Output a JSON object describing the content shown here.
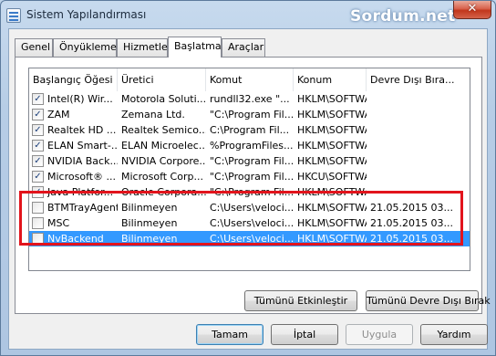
{
  "window": {
    "title": "Sistem Yapılandırması",
    "watermark": "Sordum.net",
    "close_glyph": "✕"
  },
  "tabs": [
    {
      "label": "Genel",
      "active": false
    },
    {
      "label": "Önyükleme",
      "active": false
    },
    {
      "label": "Hizmetler",
      "active": false
    },
    {
      "label": "Başlatma",
      "active": true
    },
    {
      "label": "Araçlar",
      "active": false
    }
  ],
  "list": {
    "columns": [
      "Başlangıç Öğesi",
      "Üretici",
      "Komut",
      "Konum",
      "Devre Dışı Bıra..."
    ],
    "rows": [
      {
        "checked": true,
        "item": "Intel(R) Wir...",
        "manufacturer": "Motorola Soluti...",
        "command": "rundll32.exe \"...",
        "location": "HKLM\\SOFTWARE...",
        "disabled": ""
      },
      {
        "checked": true,
        "item": "ZAM",
        "manufacturer": "Zemana Ltd.",
        "command": "\"C:\\Program Fil...",
        "location": "HKLM\\SOFTWARE...",
        "disabled": ""
      },
      {
        "checked": true,
        "item": "Realtek HD ...",
        "manufacturer": "Realtek Semico...",
        "command": "C:\\Program Fil...",
        "location": "HKLM\\SOFTWARE...",
        "disabled": ""
      },
      {
        "checked": true,
        "item": "ELAN Smart-...",
        "manufacturer": "ELAN Microelec...",
        "command": "%ProgramFiles...",
        "location": "HKLM\\SOFTWARE...",
        "disabled": ""
      },
      {
        "checked": true,
        "item": "NVIDIA Back...",
        "manufacturer": "NVIDIA Corpore...",
        "command": "\"C:\\Program Fil...",
        "location": "HKLM\\SOFTWARE...",
        "disabled": ""
      },
      {
        "checked": true,
        "item": "Microsoft® ...",
        "manufacturer": "Microsoft Corp...",
        "command": "\"C:\\Program Fil...",
        "location": "HKCU\\SOFTWARE...",
        "disabled": ""
      },
      {
        "checked": true,
        "item": "Java Platfor...",
        "manufacturer": "Oracle Corpora...",
        "command": "\"C:\\Program Fil...",
        "location": "HKLM\\SOFTWARE...",
        "disabled": ""
      },
      {
        "checked": false,
        "item": "BTMTrayAgent",
        "manufacturer": "Bilinmeyen",
        "command": "C:\\Users\\veloci...",
        "location": "HKLM\\SOFTWARE...",
        "disabled": "21.05.2015 03..."
      },
      {
        "checked": false,
        "item": "MSC",
        "manufacturer": "Bilinmeyen",
        "command": "C:\\Users\\veloci...",
        "location": "HKLM\\SOFTWARE...",
        "disabled": "21.05.2015 03..."
      },
      {
        "checked": false,
        "item": "NvBackend",
        "manufacturer": "Bilinmeyen",
        "command": "C:\\Users\\veloci...",
        "location": "HKLM\\SOFTWARE...",
        "disabled": "21.05.2015 03...",
        "selected": true
      }
    ]
  },
  "buttons": {
    "enable_all": "Tümünü Etkinleştir",
    "disable_all": "Tümünü Devre Dışı Bırak",
    "ok": "Tamam",
    "cancel": "İptal",
    "apply": "Uygula",
    "help": "Yardım"
  },
  "colors": {
    "selection": "#3399ff",
    "highlight_border": "#e2141c",
    "close_button": "#c1361b"
  }
}
